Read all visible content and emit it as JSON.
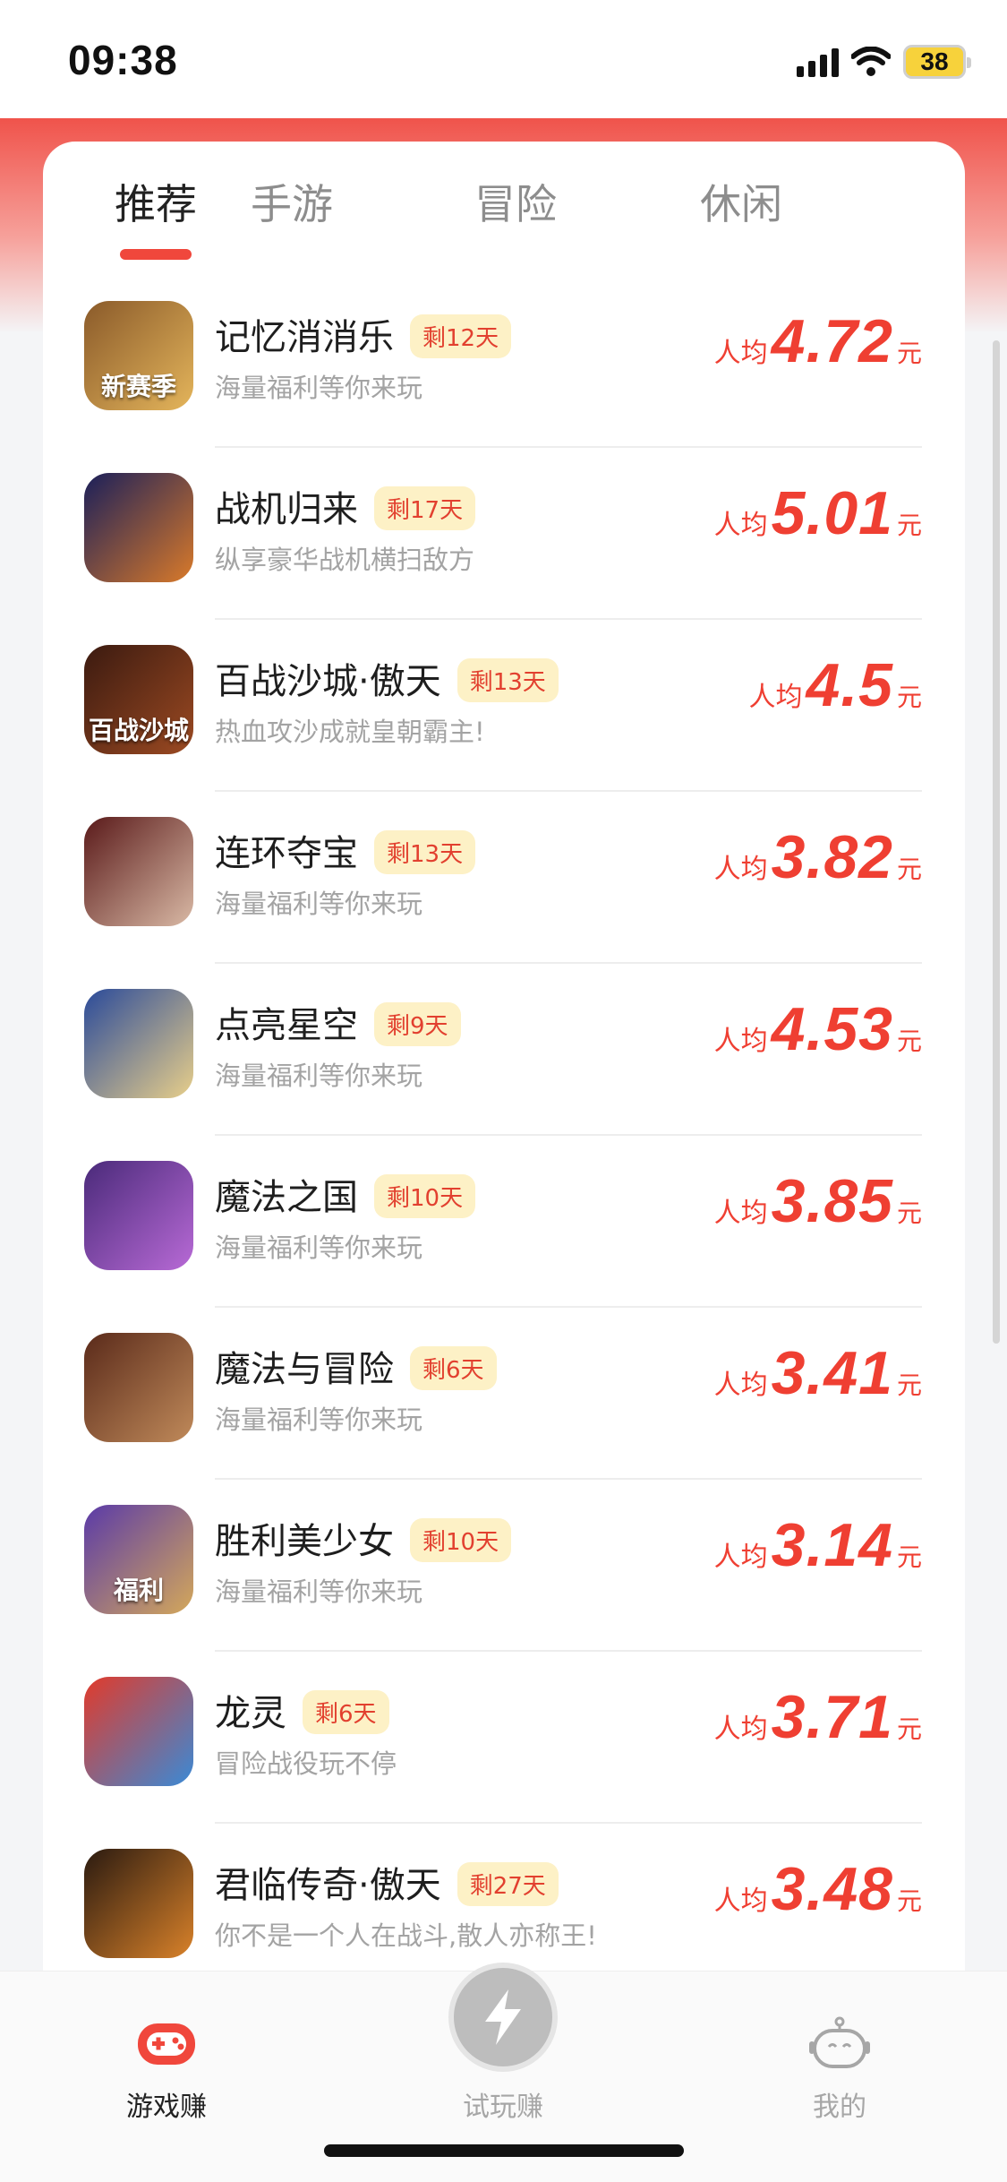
{
  "status": {
    "time": "09:38",
    "battery": "38"
  },
  "tabs": [
    {
      "label": "推荐",
      "active": true
    },
    {
      "label": "手游",
      "active": false
    },
    {
      "label": "冒险",
      "active": false
    },
    {
      "label": "休闲",
      "active": false
    }
  ],
  "price_prefix": "人均",
  "price_unit": "元",
  "games": [
    {
      "name": "记忆消消乐",
      "days": "剩12天",
      "desc": "海量福利等你来玩",
      "price": "4.72",
      "icon_text": "新赛季",
      "icon_colors": [
        "#8a5a2a",
        "#e4b55b"
      ]
    },
    {
      "name": "战机归来",
      "days": "剩17天",
      "desc": "纵享豪华战机横扫敌方",
      "price": "5.01",
      "icon_text": "",
      "icon_colors": [
        "#1a1f5a",
        "#d97a2a"
      ]
    },
    {
      "name": "百战沙城·傲天",
      "days": "剩13天",
      "desc": "热血攻沙成就皇朝霸主!",
      "price": "4.5",
      "icon_text": "百战沙城",
      "icon_colors": [
        "#3b1a10",
        "#9c4a22"
      ]
    },
    {
      "name": "连环夺宝",
      "days": "剩13天",
      "desc": "海量福利等你来玩",
      "price": "3.82",
      "icon_text": "",
      "icon_colors": [
        "#5a1a1a",
        "#d9b9a5"
      ]
    },
    {
      "name": "点亮星空",
      "days": "剩9天",
      "desc": "海量福利等你来玩",
      "price": "4.53",
      "icon_text": "",
      "icon_colors": [
        "#2a4a9a",
        "#e8cf8a"
      ]
    },
    {
      "name": "魔法之国",
      "days": "剩10天",
      "desc": "海量福利等你来玩",
      "price": "3.85",
      "icon_text": "",
      "icon_colors": [
        "#4a2a7a",
        "#b86ad6"
      ]
    },
    {
      "name": "魔法与冒险",
      "days": "剩6天",
      "desc": "海量福利等你来玩",
      "price": "3.41",
      "icon_text": "",
      "icon_colors": [
        "#5a2a1a",
        "#c08a5a"
      ]
    },
    {
      "name": "胜利美少女",
      "days": "剩10天",
      "desc": "海量福利等你来玩",
      "price": "3.14",
      "icon_text": "福利",
      "icon_colors": [
        "#5a3aa8",
        "#d4a85a"
      ]
    },
    {
      "name": "龙灵",
      "days": "剩6天",
      "desc": "冒险战役玩不停",
      "price": "3.71",
      "icon_text": "",
      "icon_colors": [
        "#e23a2a",
        "#3a8ad6"
      ]
    },
    {
      "name": "君临传奇·傲天",
      "days": "剩27天",
      "desc": "你不是一个人在战斗,散人亦称王!",
      "price": "3.48",
      "icon_text": "",
      "icon_colors": [
        "#2a1a10",
        "#d9822a"
      ]
    }
  ],
  "nav": [
    {
      "label": "游戏赚",
      "icon": "gamepad-icon",
      "active": true
    },
    {
      "label": "试玩赚",
      "icon": "lightning-icon",
      "active": false
    },
    {
      "label": "我的",
      "icon": "robot-icon",
      "active": false
    }
  ]
}
